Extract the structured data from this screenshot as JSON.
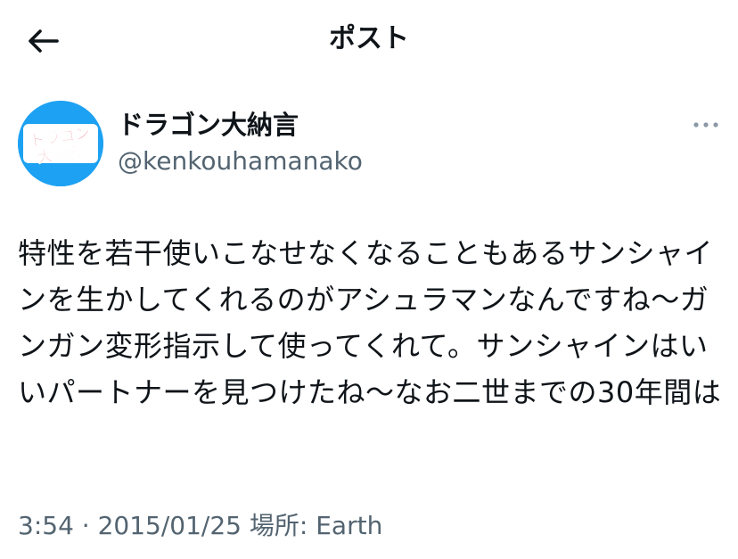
{
  "header": {
    "title": "ポスト",
    "back_icon": "arrow-left-icon"
  },
  "author": {
    "display_name": "ドラゴン大納言",
    "handle": "@kenkouhamanako",
    "avatar_line1": "ドラゴン",
    "avatar_line2": "大納言",
    "avatar_bg": "#1da1f2",
    "more_icon": "more-dots-icon"
  },
  "tweet": {
    "text": "特性を若干使いこなせなくなることもあるサンシャインを生かしてくれるのがアシュラマンなんですね〜ガンガン変形指示して使ってくれて。サンシャインはいいパートナーを見つけたね〜なお二世までの30年間は"
  },
  "meta": {
    "time": "3:54",
    "separator": "·",
    "date": "2015/01/25",
    "location_label": "場所: Earth"
  },
  "colors": {
    "text_primary": "#0f1419",
    "text_secondary": "#536471",
    "accent": "#1da1f2"
  }
}
